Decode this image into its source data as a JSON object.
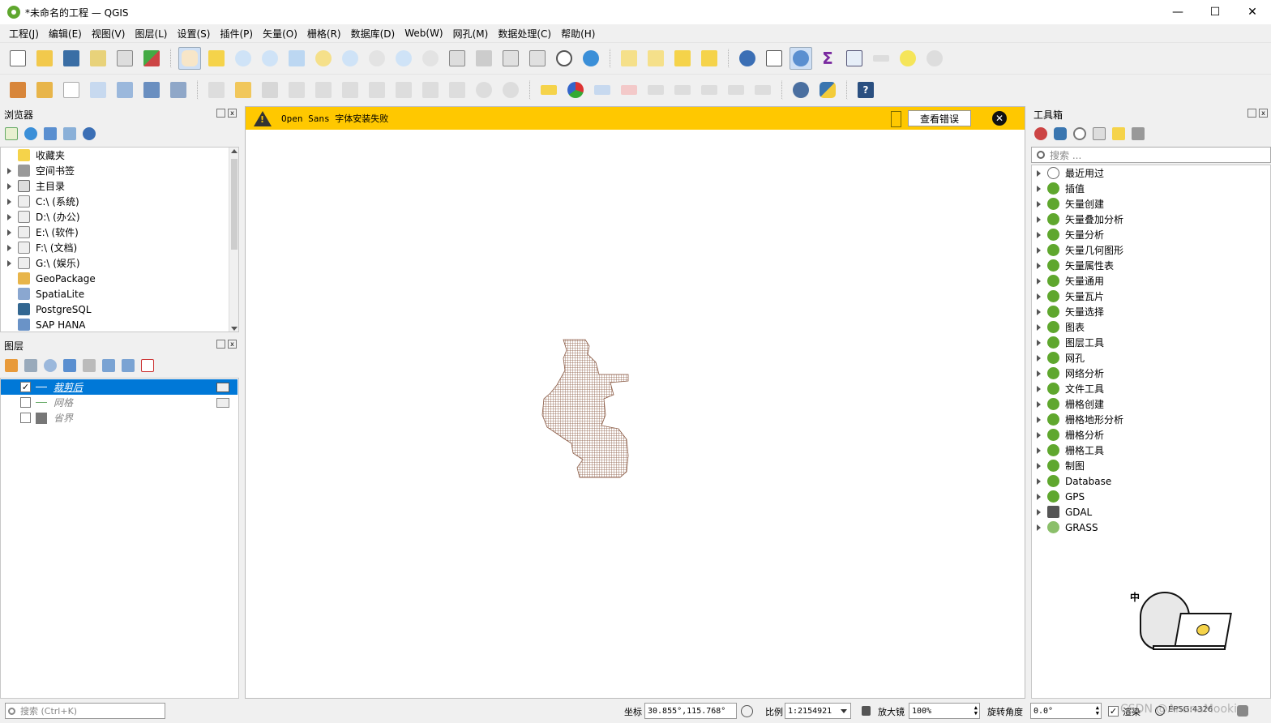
{
  "window": {
    "title": "*未命名的工程 — QGIS",
    "minimize": "—",
    "maximize": "☐",
    "close": "✕"
  },
  "menu": [
    "工程(J)",
    "编辑(E)",
    "视图(V)",
    "图层(L)",
    "设置(S)",
    "插件(P)",
    "矢量(O)",
    "栅格(R)",
    "数据库(D)",
    "Web(W)",
    "网孔(M)",
    "数据处理(C)",
    "帮助(H)"
  ],
  "browser": {
    "title": "浏览器",
    "items": [
      {
        "label": "收藏夹",
        "icon": "star-icon",
        "expand": false
      },
      {
        "label": "空间书签",
        "icon": "bookmark-icon",
        "expand": true
      },
      {
        "label": "主目录",
        "icon": "home-icon",
        "expand": true
      },
      {
        "label": "C:\\ (系统)",
        "icon": "drive-icon",
        "expand": true
      },
      {
        "label": "D:\\ (办公)",
        "icon": "drive-icon",
        "expand": true
      },
      {
        "label": "E:\\ (软件)",
        "icon": "drive-icon",
        "expand": true
      },
      {
        "label": "F:\\ (文档)",
        "icon": "drive-icon",
        "expand": true
      },
      {
        "label": "G:\\ (娱乐)",
        "icon": "drive-icon",
        "expand": true
      },
      {
        "label": "GeoPackage",
        "icon": "geopackage-icon",
        "expand": false
      },
      {
        "label": "SpatiaLite",
        "icon": "spatialite-icon",
        "expand": false
      },
      {
        "label": "PostgreSQL",
        "icon": "postgresql-icon",
        "expand": false
      },
      {
        "label": "SAP HANA",
        "icon": "saphana-icon",
        "expand": false
      }
    ]
  },
  "layers": {
    "title": "图层",
    "items": [
      {
        "label": "裁剪后",
        "checked": "✓",
        "selected": true
      },
      {
        "label": "网格",
        "checked": "",
        "selected": false
      },
      {
        "label": "省界",
        "checked": "",
        "selected": false
      }
    ]
  },
  "message": {
    "text": "Open Sans 字体安装失败",
    "button": "查看错误",
    "close": "✕"
  },
  "toolbox": {
    "title": "工具箱",
    "search_placeholder": "搜索 ...",
    "items": [
      {
        "label": "最近用过",
        "icon": "clock-icon"
      },
      {
        "label": "插值",
        "icon": "qgis-icon"
      },
      {
        "label": "矢量创建",
        "icon": "qgis-icon"
      },
      {
        "label": "矢量叠加分析",
        "icon": "qgis-icon"
      },
      {
        "label": "矢量分析",
        "icon": "qgis-icon"
      },
      {
        "label": "矢量几何图形",
        "icon": "qgis-icon"
      },
      {
        "label": "矢量属性表",
        "icon": "qgis-icon"
      },
      {
        "label": "矢量通用",
        "icon": "qgis-icon"
      },
      {
        "label": "矢量瓦片",
        "icon": "qgis-icon"
      },
      {
        "label": "矢量选择",
        "icon": "qgis-icon"
      },
      {
        "label": "图表",
        "icon": "qgis-icon"
      },
      {
        "label": "图层工具",
        "icon": "qgis-icon"
      },
      {
        "label": "网孔",
        "icon": "qgis-icon"
      },
      {
        "label": "网络分析",
        "icon": "qgis-icon"
      },
      {
        "label": "文件工具",
        "icon": "qgis-icon"
      },
      {
        "label": "栅格创建",
        "icon": "qgis-icon"
      },
      {
        "label": "栅格地形分析",
        "icon": "qgis-icon"
      },
      {
        "label": "栅格分析",
        "icon": "qgis-icon"
      },
      {
        "label": "栅格工具",
        "icon": "qgis-icon"
      },
      {
        "label": "制图",
        "icon": "qgis-icon"
      },
      {
        "label": "Database",
        "icon": "qgis-icon"
      },
      {
        "label": "GPS",
        "icon": "qgis-icon"
      },
      {
        "label": "GDAL",
        "icon": "gdal-icon"
      },
      {
        "label": "GRASS",
        "icon": "grass-icon"
      }
    ]
  },
  "status": {
    "search_placeholder": "搜索 (Ctrl+K)",
    "coord_label": "坐标",
    "coord_value": "30.855°,115.768°",
    "scale_label": "比例",
    "scale_value": "1:2154921",
    "magnifier_label": "放大镜",
    "magnifier_value": "100%",
    "rotation_label": "旋转角度",
    "rotation_value": "0.0°",
    "render_label": "渲染",
    "epsg": "EPSG:4326",
    "watermark": "CSDN @AnanaMookin"
  },
  "mascot_text": "中"
}
